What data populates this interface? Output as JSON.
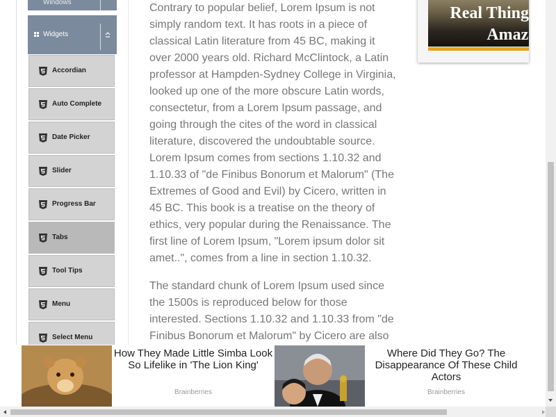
{
  "sidebar": {
    "prev_group_label": "Windows",
    "group_label": "Widgets",
    "items": [
      {
        "label": "Accordian"
      },
      {
        "label": "Auto Complete"
      },
      {
        "label": "Date Picker"
      },
      {
        "label": "Slider"
      },
      {
        "label": "Progress Bar"
      },
      {
        "label": "Tabs",
        "active": true
      },
      {
        "label": "Tool Tips"
      },
      {
        "label": "Menu"
      },
      {
        "label": "Select Menu"
      }
    ]
  },
  "content": {
    "paragraph1": "Contrary to popular belief, Lorem Ipsum is not simply random text. It has roots in a piece of classical Latin literature from 45 BC, making it over 2000 years old. Richard McClintock, a Latin professor at Hampden-Sydney College in Virginia, looked up one of the more obscure Latin words, consectetur, from a Lorem Ipsum passage, and going through the cites of the word in classical literature, discovered the undoubtable source. Lorem Ipsum comes from sections 1.10.32 and 1.10.33 of \"de Finibus Bonorum et Malorum\" (The Extremes of Good and Evil) by Cicero, written in 45 BC. This book is a treatise on the theory of ethics, very popular during the Renaissance. The first line of Lorem Ipsum, \"Lorem ipsum dolor sit amet..\", comes from a line in section 1.10.32.",
    "paragraph2": "The standard chunk of Lorem Ipsum used since the 1500s is reproduced below for those interested. Sections 1.10.32 and 1.10.33 from \"de Finibus Bonorum et Malorum\" by Cicero are also"
  },
  "ad": {
    "title_line1": "Real Thing,",
    "title_line2": "Amazi",
    "accent_color": "#e8a122"
  },
  "banner": {
    "cards": [
      {
        "title": "How They Made Little Simba Look So Lifelike in 'The Lion King'",
        "source": "Brainberries"
      },
      {
        "title": "Where Did They Go? The Disappearance Of These Child Actors",
        "source": "Brainberries"
      }
    ]
  },
  "icons": {
    "menu_item": "html5-icon",
    "group": "grid-icon",
    "collapse": "collapse-up-icon"
  }
}
